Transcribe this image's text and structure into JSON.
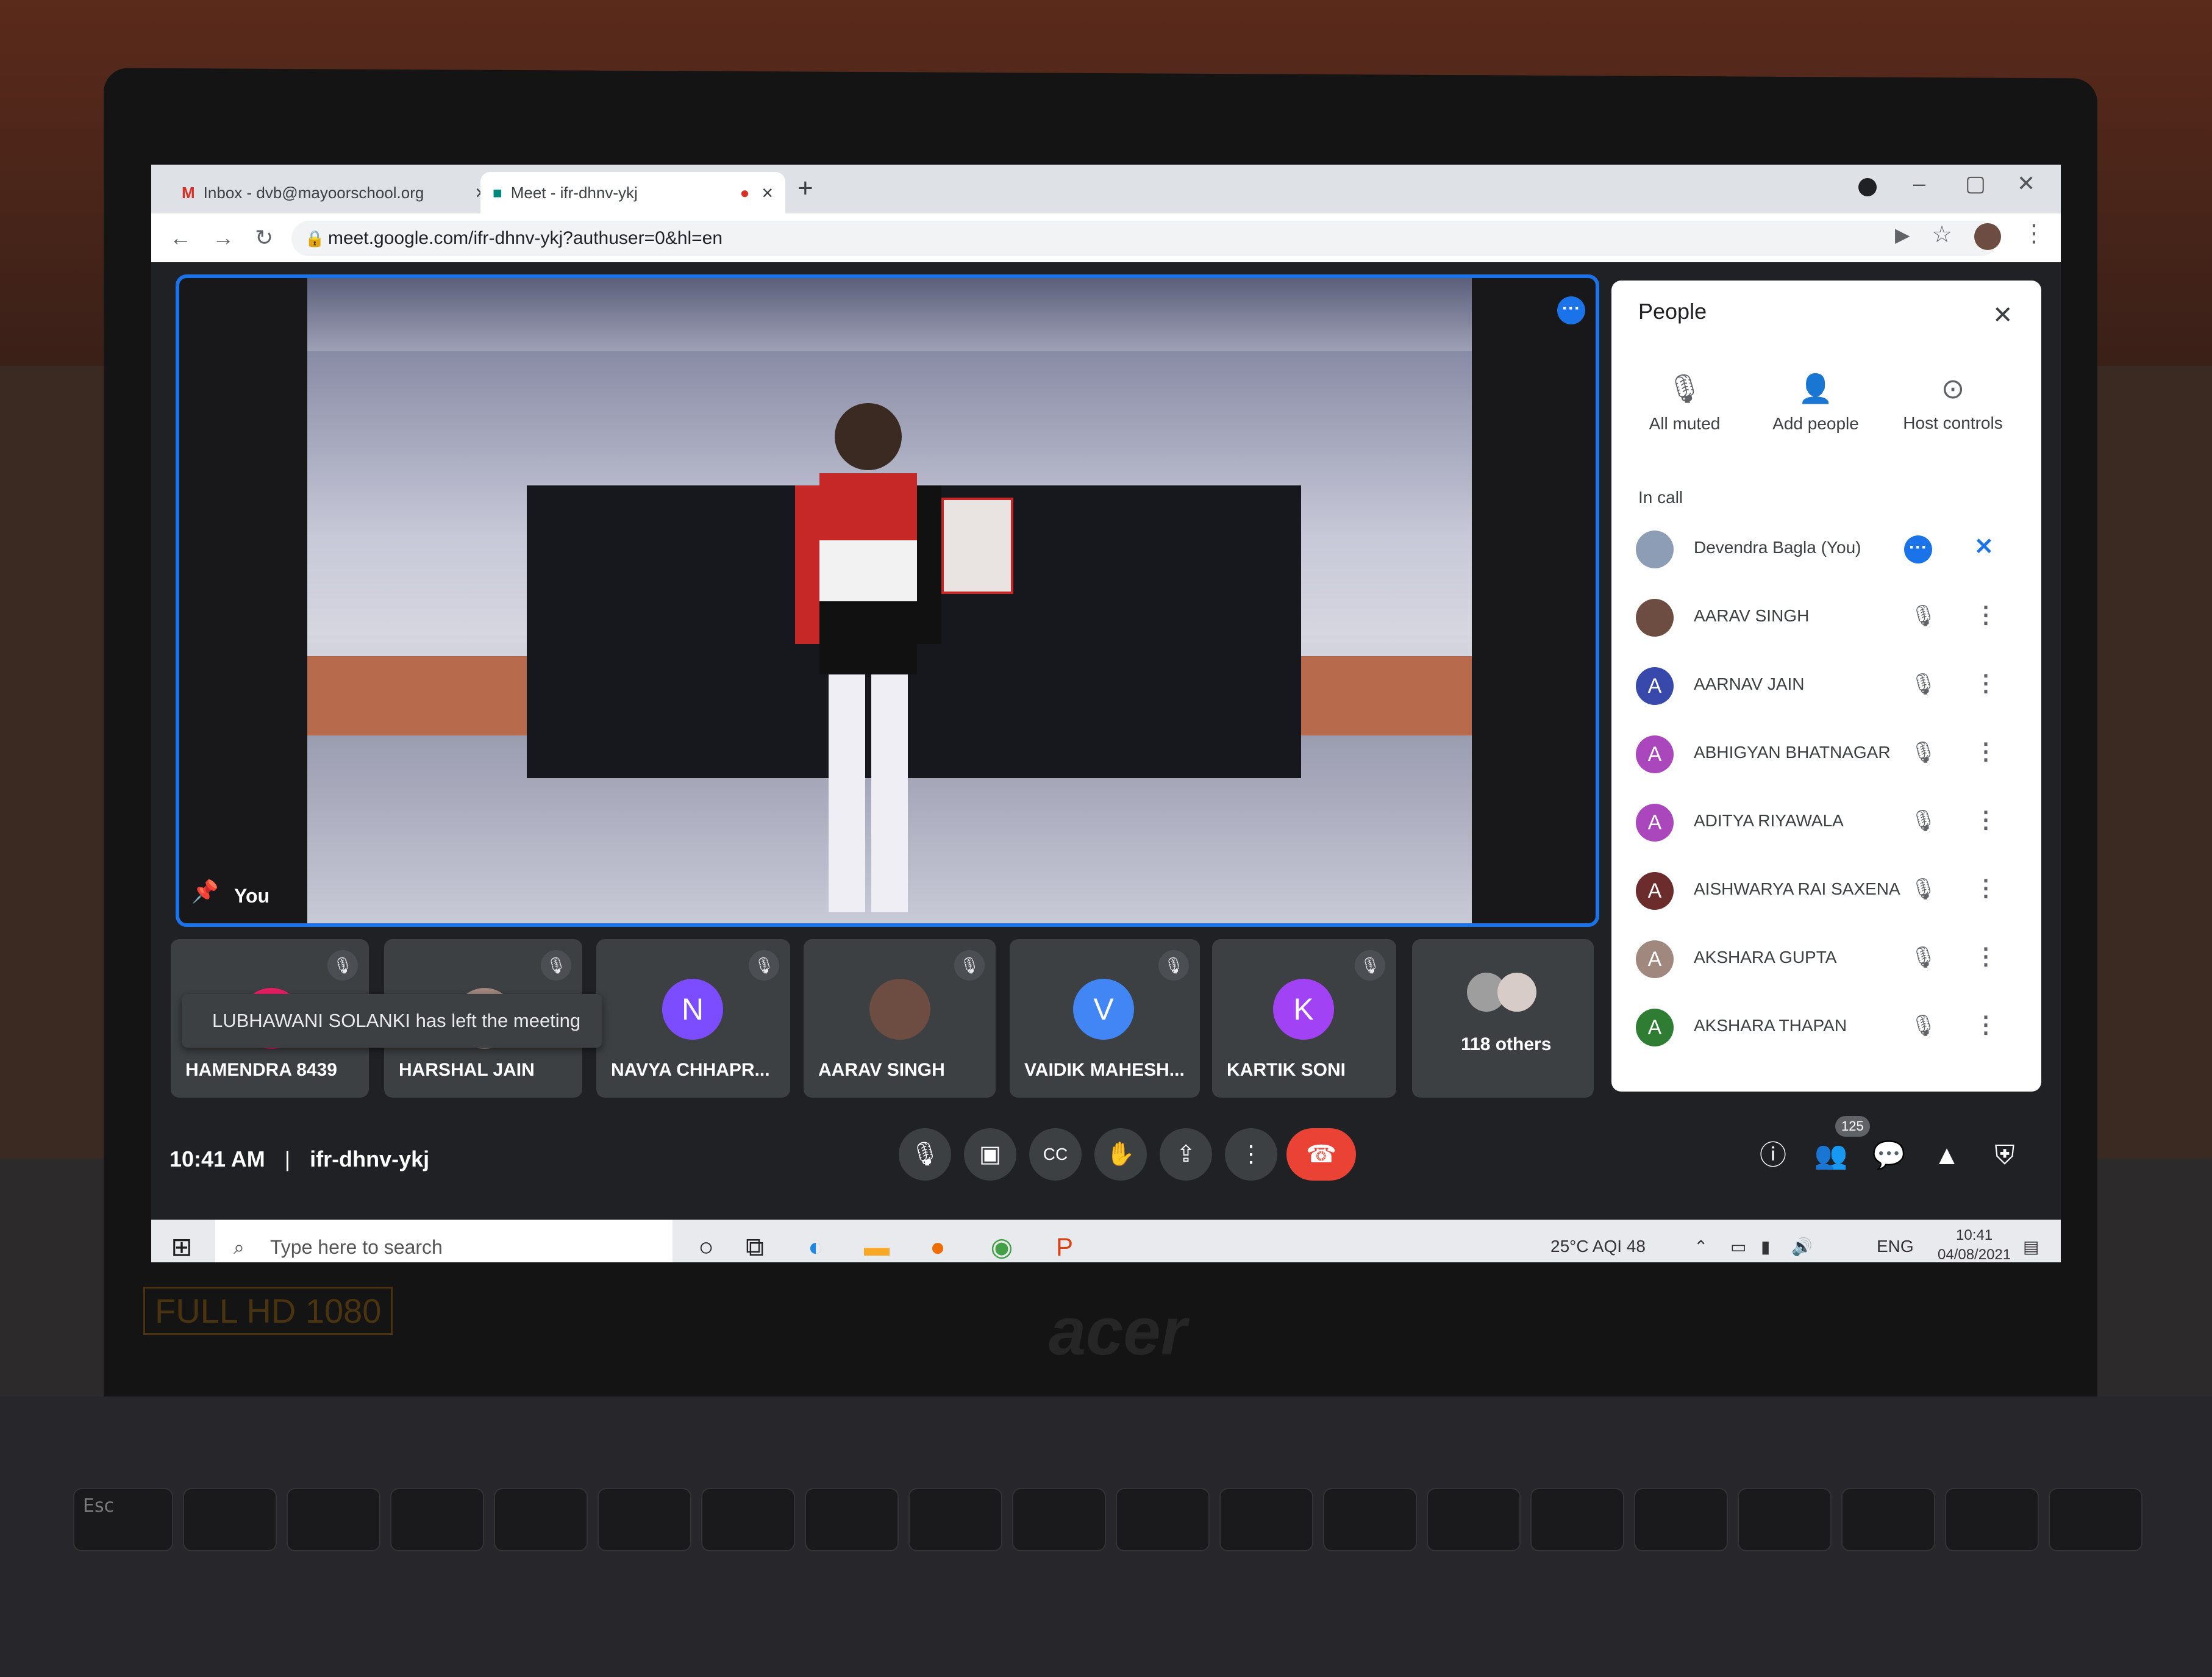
{
  "browser": {
    "tabs": [
      {
        "label": "Inbox - dvb@mayoorschool.org",
        "close": "×"
      },
      {
        "label": "Meet - ifr-dhnv-ykj",
        "close": "×"
      }
    ],
    "new_tab": "+",
    "url": "meet.google.com/ifr-dhnv-ykj?authuser=0&hl=en"
  },
  "meet": {
    "main_tile_label": "You",
    "strip_tiles": [
      {
        "name": "HAMENDRA 8439"
      },
      {
        "name": "HARSHAL JAIN"
      },
      {
        "name": "NAVYA CHHAPR...",
        "initial": "N",
        "color": "#7c4dff"
      },
      {
        "name": "AARAV SINGH"
      },
      {
        "name": "VAIDIK MAHESH...",
        "initial": "V",
        "color": "#4285f4"
      },
      {
        "name": "KARTIK SONI",
        "initial": "K",
        "color": "#a142f4"
      },
      {
        "name": "118 others"
      }
    ],
    "toast": "LUBHAWANI SOLANKI has left the meeting",
    "time": "10:41 AM",
    "separator": "|",
    "meeting_code": "ifr-dhnv-ykj",
    "participants_badge": "125"
  },
  "people_panel": {
    "title": "People",
    "actions": [
      {
        "label": "All muted",
        "icon": "mic-off-icon"
      },
      {
        "label": "Add people",
        "icon": "add-person-icon"
      },
      {
        "label": "Host controls",
        "icon": "toggle-icon"
      }
    ],
    "section": "In call",
    "participants": [
      {
        "name": "Devendra Bagla (You)",
        "initial": "",
        "color": "#8d9db6"
      },
      {
        "name": "AARAV SINGH",
        "initial": "",
        "color": "#6d4c41"
      },
      {
        "name": "AARNAV JAIN",
        "initial": "A",
        "color": "#3949ab"
      },
      {
        "name": "ABHIGYAN BHATNAGAR",
        "initial": "A",
        "color": "#ab47bc"
      },
      {
        "name": "ADITYA RIYAWALA",
        "initial": "A",
        "color": "#ab47bc"
      },
      {
        "name": "AISHWARYA RAI SAXENA",
        "initial": "A",
        "color": "#6d2c2c"
      },
      {
        "name": "AKSHARA GUPTA",
        "initial": "A",
        "color": "#a1887f"
      },
      {
        "name": "AKSHARA THAPAN",
        "initial": "A",
        "color": "#2e7d32"
      }
    ]
  },
  "taskbar": {
    "search_placeholder": "Type here to search",
    "weather": "25°C  AQI 48",
    "lang": "ENG",
    "clock_time": "10:41",
    "clock_date": "04/08/2021"
  },
  "laptop": {
    "brand": "acer",
    "badge": "FULL HD 1080"
  },
  "colors": {
    "accent": "#1a73e8",
    "hangup": "#ea4335",
    "meet_bg": "#202124"
  }
}
